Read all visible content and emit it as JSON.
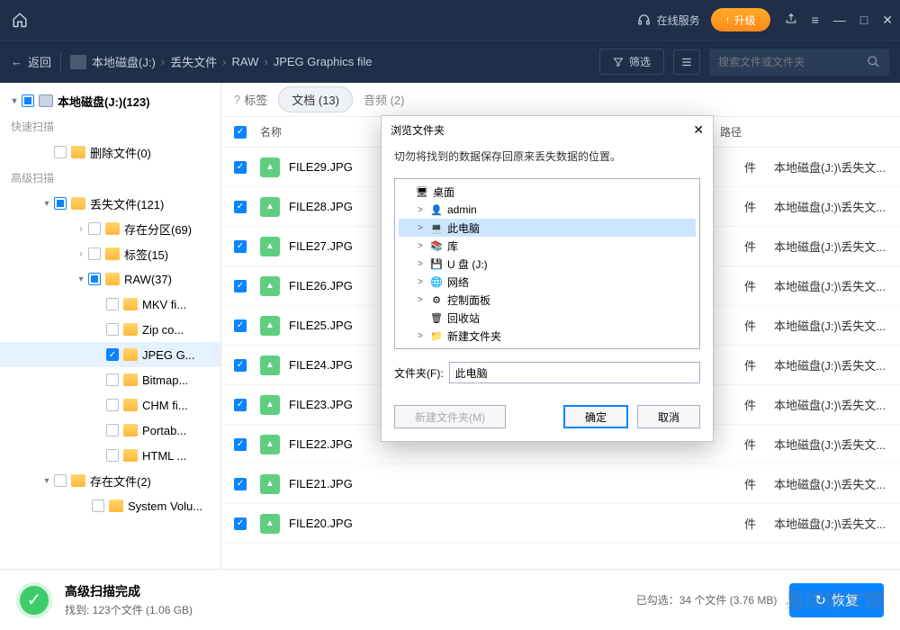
{
  "titlebar": {
    "online_service": "在线服务",
    "upgrade": "升级"
  },
  "toolbar": {
    "back": "返回",
    "breadcrumb": [
      "本地磁盘(J:)",
      "丢失文件",
      "RAW",
      "JPEG Graphics file"
    ],
    "filter": "筛选",
    "search_placeholder": "搜索文件或文件夹"
  },
  "sidebar": {
    "root": "本地磁盘(J:)(123)",
    "quick_scan": "快速扫描",
    "deleted": "删除文件(0)",
    "adv_scan": "高级扫描",
    "lost": "丢失文件(121)",
    "exist_part": "存在分区(69)",
    "tags": "标签(15)",
    "raw": "RAW(37)",
    "raw_children": [
      "MKV fi...",
      "Zip co...",
      "JPEG G...",
      "Bitmap...",
      "CHM fi...",
      "Portab...",
      "HTML ..."
    ],
    "exist_files": "存在文件(2)",
    "exist_files_children": [
      "System Volu..."
    ]
  },
  "tabs": {
    "label": "标签",
    "doc": "文档 (13)",
    "audio": "音频 (2)"
  },
  "cols": {
    "name": "名称",
    "path": "路径"
  },
  "files": [
    {
      "name": "FILE29.JPG",
      "suffix": "件",
      "path": "本地磁盘(J:)\\丢失文..."
    },
    {
      "name": "FILE28.JPG",
      "suffix": "件",
      "path": "本地磁盘(J:)\\丢失文..."
    },
    {
      "name": "FILE27.JPG",
      "suffix": "件",
      "path": "本地磁盘(J:)\\丢失文..."
    },
    {
      "name": "FILE26.JPG",
      "suffix": "件",
      "path": "本地磁盘(J:)\\丢失文..."
    },
    {
      "name": "FILE25.JPG",
      "suffix": "件",
      "path": "本地磁盘(J:)\\丢失文..."
    },
    {
      "name": "FILE24.JPG",
      "suffix": "件",
      "path": "本地磁盘(J:)\\丢失文..."
    },
    {
      "name": "FILE23.JPG",
      "suffix": "件",
      "path": "本地磁盘(J:)\\丢失文..."
    },
    {
      "name": "FILE22.JPG",
      "suffix": "件",
      "path": "本地磁盘(J:)\\丢失文..."
    },
    {
      "name": "FILE21.JPG",
      "suffix": "件",
      "path": "本地磁盘(J:)\\丢失文..."
    },
    {
      "name": "FILE20.JPG",
      "suffix": "件",
      "path": "本地磁盘(J:)\\丢失文..."
    }
  ],
  "footer": {
    "title": "高级扫描完成",
    "subtitle": "找到: 123个文件 (1.06 GB)",
    "selected": "已勾选：34 个文件 (3.76 MB)",
    "recover": "恢复"
  },
  "dialog": {
    "title": "浏览文件夹",
    "msg": "切勿将找到的数据保存回原来丢失数据的位置。",
    "items": [
      {
        "icon": "🖥",
        "label": "桌面",
        "chev": ""
      },
      {
        "icon": "👤",
        "label": "admin",
        "chev": ">",
        "indent": 1
      },
      {
        "icon": "💻",
        "label": "此电脑",
        "chev": ">",
        "indent": 1,
        "sel": true
      },
      {
        "icon": "📚",
        "label": "库",
        "chev": ">",
        "indent": 1
      },
      {
        "icon": "💾",
        "label": "U 盘 (J:)",
        "chev": ">",
        "indent": 1
      },
      {
        "icon": "🌐",
        "label": "网络",
        "chev": ">",
        "indent": 1
      },
      {
        "icon": "⚙",
        "label": "控制面板",
        "chev": ">",
        "indent": 1
      },
      {
        "icon": "🗑",
        "label": "回收站",
        "chev": "",
        "indent": 1
      },
      {
        "icon": "📁",
        "label": "新建文件夹",
        "chev": ">",
        "indent": 1
      }
    ],
    "folder_label": "文件夹(F):",
    "folder_value": "此电脑",
    "new_folder": "新建文件夹(M)",
    "ok": "确定",
    "cancel": "取消"
  },
  "watermark": "易坊好文馆"
}
